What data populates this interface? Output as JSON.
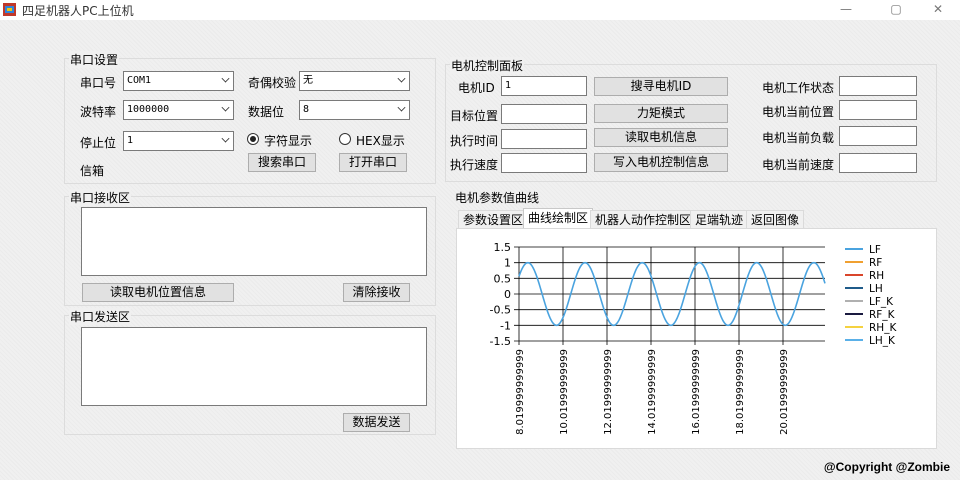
{
  "window": {
    "title": "四足机器人PC上位机",
    "min": "—",
    "max": "▢",
    "close": "✕"
  },
  "serial": {
    "group_title": "串口设置",
    "port_label": "串口号",
    "port_value": "COM1",
    "parity_label": "奇偶校验",
    "parity_value": "无",
    "baud_label": "波特率",
    "baud_value": "1000000",
    "databits_label": "数据位",
    "databits_value": "8",
    "stopbits_label": "停止位",
    "stopbits_value": "1",
    "char_display": "字符显示",
    "hex_display": "HEX显示",
    "mailbox_label": "信箱",
    "search_button": "搜索串口",
    "open_button": "打开串口"
  },
  "receive": {
    "group_title": "串口接收区",
    "read_button": "读取电机位置信息",
    "clear_button": "清除接收"
  },
  "send": {
    "group_title": "串口发送区",
    "send_button": "数据发送"
  },
  "motor": {
    "group_title": "电机控制面板",
    "id_label": "电机ID",
    "id_value": "1",
    "target_label": "目标位置",
    "time_label": "执行时间",
    "speed_label": "执行速度",
    "search_button": "搜寻电机ID",
    "torque_button": "力矩模式",
    "read_button": "读取电机信息",
    "write_button": "写入电机控制信息",
    "status_label": "电机工作状态",
    "pos_label": "电机当前位置",
    "load_label": "电机当前负载",
    "cur_speed_label": "电机当前速度"
  },
  "curve": {
    "group_title": "电机参数值曲线",
    "tabs": [
      "参数设置区",
      "曲线绘制区",
      "机器人动作控制区",
      "足端轨迹",
      "返回图像"
    ]
  },
  "footer": {
    "copyright": "@Copyright @Zombie"
  },
  "chart_data": {
    "type": "line",
    "ylim": [
      -1.5,
      1.5
    ],
    "y_ticks": [
      "1.5",
      "1",
      "0.5",
      "0",
      "-0.5",
      "-1",
      "-1.5"
    ],
    "x_tick_labels": [
      "8.019999999999",
      "10.01999999999",
      "12.01999999999",
      "14.01999999999",
      "16.01999999999",
      "18.01999999999",
      "20.01999999999"
    ],
    "legend": [
      {
        "name": "LF",
        "color": "#4aa3df"
      },
      {
        "name": "RF",
        "color": "#f0a030"
      },
      {
        "name": "RH",
        "color": "#d9452b"
      },
      {
        "name": "LH",
        "color": "#1f5b8a"
      },
      {
        "name": "LF_K",
        "color": "#b0b0b0"
      },
      {
        "name": "RF_K",
        "color": "#1a1a40"
      },
      {
        "name": "RH_K",
        "color": "#f5d240"
      },
      {
        "name": "LH_K",
        "color": "#5ab0e8"
      }
    ],
    "series": [
      {
        "name": "LF",
        "period": 2.6,
        "amplitude": 1
      }
    ]
  }
}
